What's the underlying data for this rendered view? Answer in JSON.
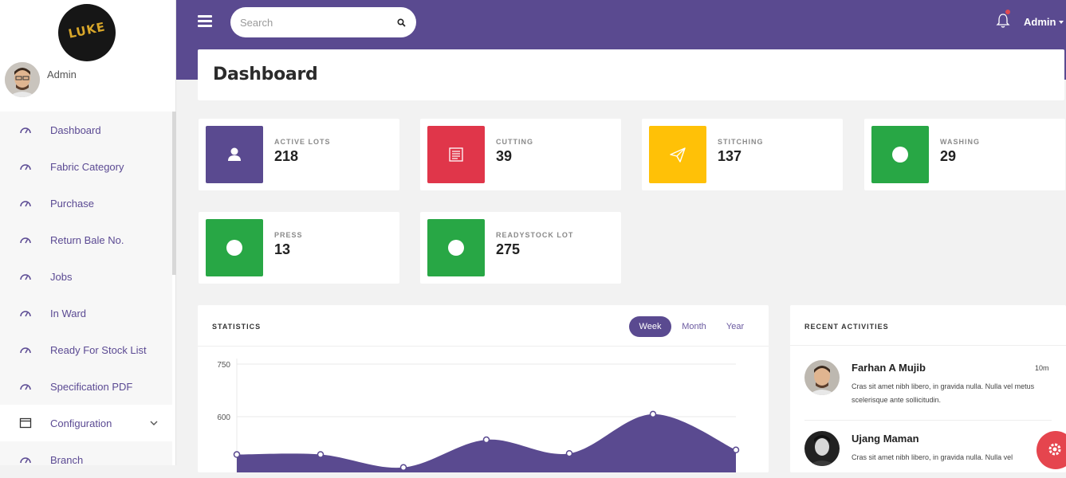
{
  "sidebar": {
    "user_name": "Admin",
    "items": [
      {
        "label": "Dashboard",
        "icon": "speedometer-icon"
      },
      {
        "label": "Fabric Category",
        "icon": "speedometer-icon"
      },
      {
        "label": "Purchase",
        "icon": "speedometer-icon"
      },
      {
        "label": "Return Bale No.",
        "icon": "speedometer-icon"
      },
      {
        "label": "Jobs",
        "icon": "speedometer-icon"
      },
      {
        "label": "In Ward",
        "icon": "speedometer-icon"
      },
      {
        "label": "Ready For Stock List",
        "icon": "speedometer-icon"
      },
      {
        "label": "Specification PDF",
        "icon": "speedometer-icon"
      },
      {
        "label": "Configuration",
        "icon": "window-icon"
      },
      {
        "label": "Branch",
        "icon": "speedometer-icon"
      }
    ]
  },
  "topbar": {
    "search_placeholder": "Search",
    "user_label": "Admin"
  },
  "page": {
    "title": "Dashboard"
  },
  "cards": [
    {
      "label": "ACTIVE LOTS",
      "value": "218",
      "color": "#5a4a90",
      "icon": "user-icon"
    },
    {
      "label": "CUTTING",
      "value": "39",
      "color": "#e0364a",
      "icon": "document-icon"
    },
    {
      "label": "STITCHING",
      "value": "137",
      "color": "#ffc107",
      "icon": "paper-plane-icon"
    },
    {
      "label": "WASHING",
      "value": "29",
      "color": "#28a745",
      "icon": "circle-icon"
    },
    {
      "label": "PRESS",
      "value": "13",
      "color": "#28a745",
      "icon": "circle-icon"
    },
    {
      "label": "READYSTOCK LOT",
      "value": "275",
      "color": "#28a745",
      "icon": "circle-icon"
    }
  ],
  "statistics": {
    "title": "STATISTICS",
    "tabs": [
      "Week",
      "Month",
      "Year"
    ],
    "active_tab": "Week"
  },
  "chart_data": {
    "type": "area",
    "title": "STATISTICS",
    "y_ticks": [
      "750",
      "600"
    ],
    "ylim_visible": [
      560,
      750
    ],
    "series": [
      {
        "color": "#5a4a90",
        "x": [
          0,
          1,
          2,
          3,
          4,
          5,
          6
        ],
        "values": [
          492,
          492,
          455,
          534,
          495,
          607,
          505
        ]
      }
    ],
    "grid": true
  },
  "activities": {
    "title": "RECENT ACTIVITIES",
    "items": [
      {
        "name": "Farhan A Mujib",
        "time": "10m",
        "text": "Cras sit amet nibh libero, in gravida nulla. Nulla vel metus scelerisque ante sollicitudin."
      },
      {
        "name": "Ujang Maman",
        "time": "",
        "text": "Cras sit amet nibh libero, in gravida nulla. Nulla vel"
      }
    ]
  },
  "colors": {
    "brand": "#5a4a90",
    "settings_fab": "#e5454e"
  }
}
